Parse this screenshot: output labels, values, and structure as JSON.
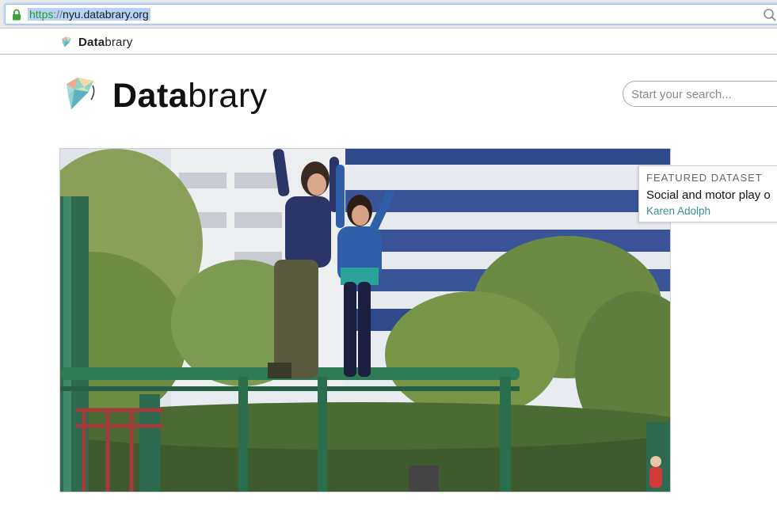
{
  "browser": {
    "url_scheme": "https",
    "url_separator": "://",
    "url_host": "nyu.databrary.org"
  },
  "bookmarks": [
    {
      "label_bold": "Data",
      "label_rest": "brary"
    }
  ],
  "site": {
    "title_bold": "Data",
    "title_rest": "brary"
  },
  "search": {
    "placeholder": "Start your search..."
  },
  "featured": {
    "heading": "FEATURED DATASET",
    "title": "Social and motor play o",
    "author": "Karen Adolph"
  },
  "colors": {
    "brand_teal": "#3b8f94",
    "https_green": "#2b9a2b",
    "url_highlight": "#b5d3f7"
  },
  "icons": {
    "lock": "lock-icon",
    "search": "magnifier-icon",
    "logo": "databrary-logo-icon"
  }
}
